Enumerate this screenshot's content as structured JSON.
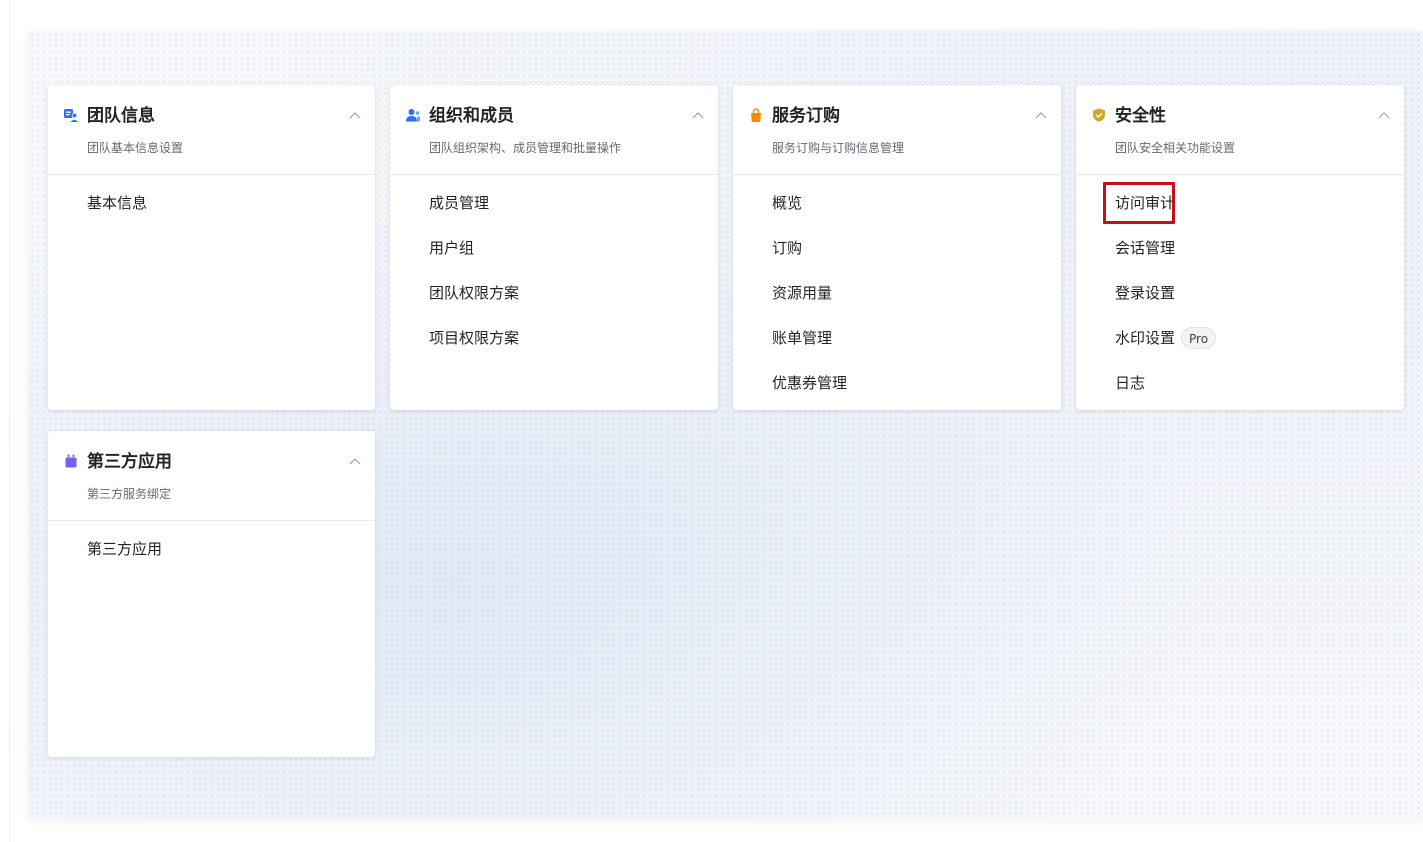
{
  "cards": [
    {
      "icon": "team-info-icon",
      "icon_color": "#2b6fff",
      "title": "团队信息",
      "subtitle": "团队基本信息设置",
      "items": [
        {
          "label": "基本信息"
        }
      ]
    },
    {
      "icon": "members-icon",
      "icon_color": "#2b6fff",
      "title": "组织和成员",
      "subtitle": "团队组织架构、成员管理和批量操作",
      "items": [
        {
          "label": "成员管理"
        },
        {
          "label": "用户组"
        },
        {
          "label": "团队权限方案"
        },
        {
          "label": "项目权限方案"
        }
      ]
    },
    {
      "icon": "shopping-bag-icon",
      "icon_color": "#ff8a00",
      "title": "服务订购",
      "subtitle": "服务订购与订购信息管理",
      "items": [
        {
          "label": "概览"
        },
        {
          "label": "订购"
        },
        {
          "label": "资源用量"
        },
        {
          "label": "账单管理"
        },
        {
          "label": "优惠券管理"
        }
      ]
    },
    {
      "icon": "shield-check-icon",
      "icon_color": "#d4a72c",
      "title": "安全性",
      "subtitle": "团队安全相关功能设置",
      "items": [
        {
          "label": "访问审计",
          "highlighted": true
        },
        {
          "label": "会话管理"
        },
        {
          "label": "登录设置"
        },
        {
          "label": "水印设置",
          "badge": "Pro"
        },
        {
          "label": "日志"
        }
      ]
    },
    {
      "icon": "calendar-app-icon",
      "icon_color": "#7a5cf0",
      "title": "第三方应用",
      "subtitle": "第三方服务绑定",
      "items": [
        {
          "label": "第三方应用"
        }
      ]
    }
  ],
  "colors": {
    "highlight_border": "#c4101b"
  }
}
